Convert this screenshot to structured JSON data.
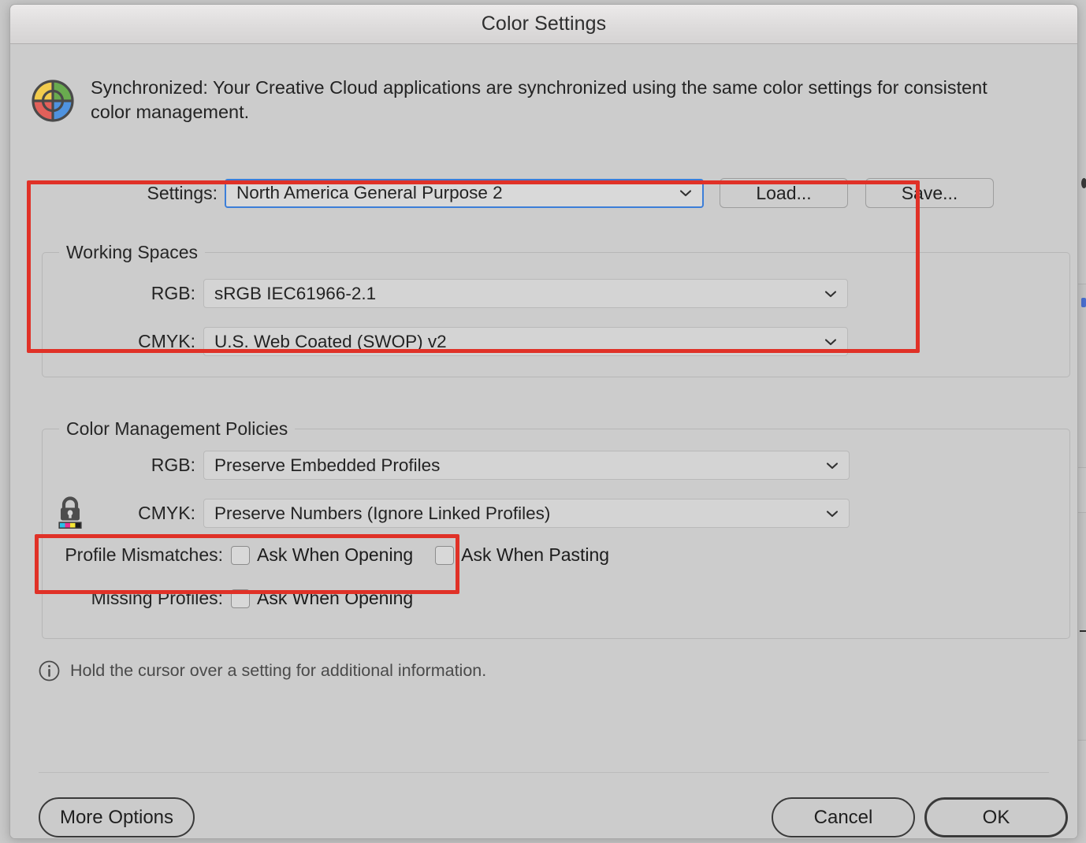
{
  "window": {
    "title": "Color Settings"
  },
  "banner": {
    "icon": "color-wheel-sync-icon",
    "text": "Synchronized: Your Creative Cloud applications are synchronized using the same color settings for consistent color management."
  },
  "settings": {
    "label": "Settings:",
    "value": "North America General Purpose 2",
    "load_label": "Load...",
    "save_label": "Save..."
  },
  "working_spaces": {
    "title": "Working Spaces",
    "rgb_label": "RGB:",
    "rgb_value": "sRGB IEC61966-2.1",
    "cmyk_label": "CMYK:",
    "cmyk_value": "U.S. Web Coated (SWOP) v2"
  },
  "color_management_policies": {
    "title": "Color Management Policies",
    "rgb_label": "RGB:",
    "rgb_value": "Preserve Embedded Profiles",
    "cmyk_label": "CMYK:",
    "cmyk_value": "Preserve Numbers (Ignore Linked Profiles)",
    "lock_icon": "cmyk-lock-icon",
    "profile_mismatches_label": "Profile Mismatches:",
    "mismatch_ask_opening": "Ask When Opening",
    "mismatch_ask_pasting": "Ask When Pasting",
    "missing_profiles_label": "Missing Profiles:",
    "missing_ask_opening": "Ask When Opening"
  },
  "info": {
    "icon": "info-circle-icon",
    "text": "Hold the cursor over a setting for additional information."
  },
  "footer": {
    "more_options_label": "More Options",
    "cancel_label": "Cancel",
    "ok_label": "OK"
  },
  "colors": {
    "annotation": "#e03127",
    "focus_ring": "#3c7ed8",
    "dialog_bg": "#cccccc",
    "titlebar": "#e4e2e2"
  }
}
